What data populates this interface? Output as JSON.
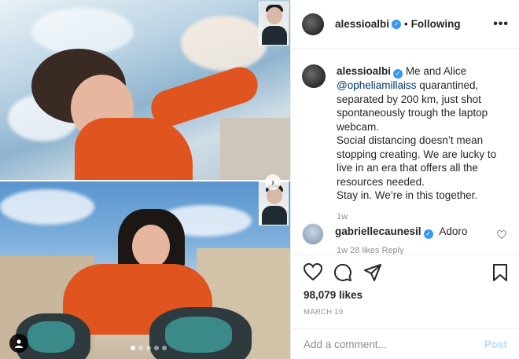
{
  "post": {
    "author": "alessioalbi",
    "follow_state": "Following",
    "separator": "•",
    "more_label": "•••",
    "caption_lines": [
      "Me and Alice",
      "@opheliamillaiss",
      " quarantined, separated by 200 km, just shot spontaneously trough the laptop webcam.",
      "Social distancing doesn’t mean stopping creating. We are lucky to live in an era that offers all the resources needed.",
      "Stay in. We’re in this together."
    ],
    "caption_time": "1w",
    "likes": "98,079 likes",
    "date": "MARCH 19"
  },
  "comment": {
    "user": "gabriellecaunesil",
    "text": "Adoro",
    "meta": "1w   28 likes   Reply"
  },
  "composer": {
    "placeholder": "Add a comment...",
    "post_label": "Post"
  },
  "carousel": {
    "next_glyph": "›",
    "dots": 5,
    "active_dot": 0
  },
  "colors": {
    "verified": "#3897f0",
    "mention": "#00376b",
    "post_disabled": "#b2dffc",
    "meta_gray": "#8e8e8e"
  },
  "icons": [
    "heart-icon",
    "comment-icon",
    "share-icon",
    "bookmark-icon",
    "verified-icon",
    "user-tag-icon",
    "chevron-right-icon",
    "more-icon"
  ]
}
